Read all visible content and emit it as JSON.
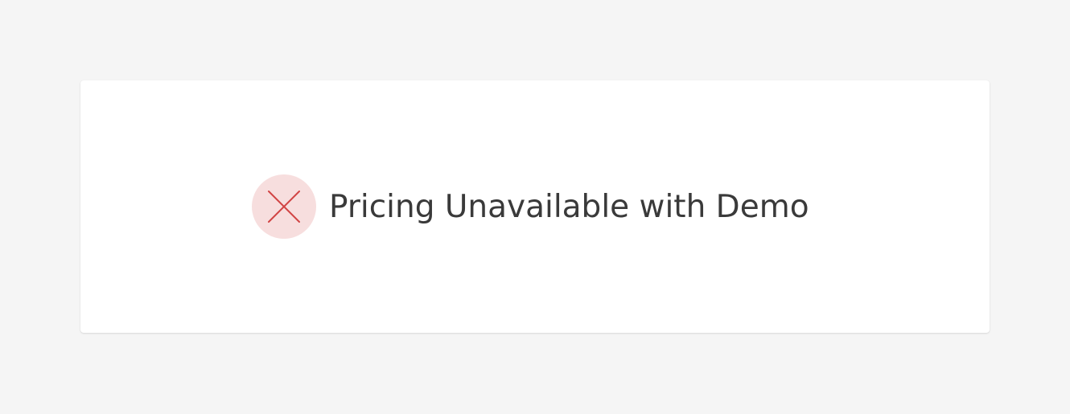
{
  "notice": {
    "icon": "close-icon",
    "message": "Pricing Unavailable with Demo"
  },
  "colors": {
    "page_background": "#f5f5f5",
    "card_background": "#ffffff",
    "icon_circle": "#f7dede",
    "icon_stroke": "#d14444",
    "text": "#3a3a3a"
  }
}
